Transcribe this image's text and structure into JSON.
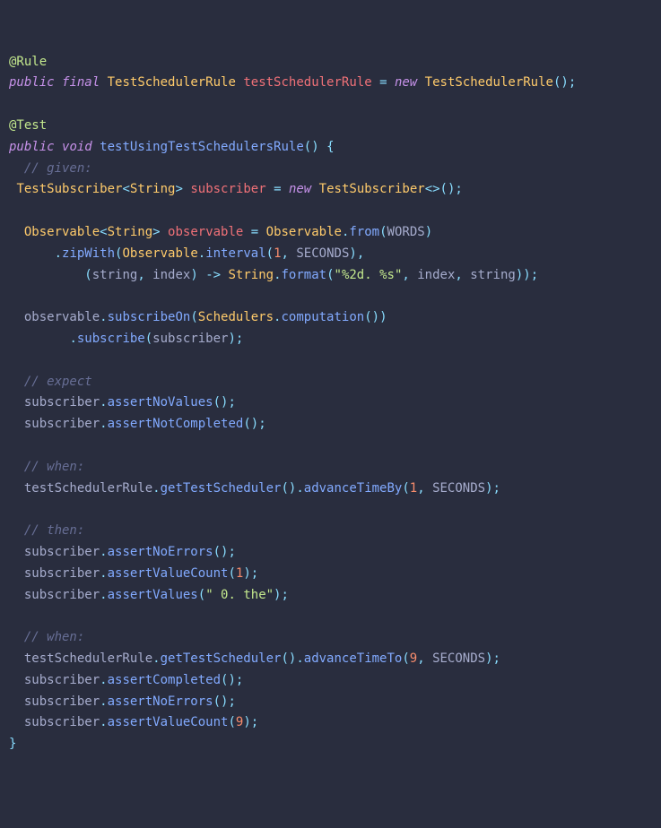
{
  "code": {
    "annotation_rule": "@Rule",
    "kw_public": "public",
    "kw_final": "final",
    "kw_new": "new",
    "kw_void": "void",
    "type_TestSchedulerRule": "TestSchedulerRule",
    "var_testSchedulerRule": "testSchedulerRule",
    "annotation_test": "@Test",
    "method_testUsingTestSchedulersRule": "testUsingTestSchedulersRule",
    "comment_given": "// given:",
    "type_TestSubscriber": "TestSubscriber",
    "type_String": "String",
    "var_subscriber": "subscriber",
    "type_Observable": "Observable",
    "var_observable": "observable",
    "call_from": "from",
    "const_WORDS": "WORDS",
    "call_zipWith": "zipWith",
    "call_interval": "interval",
    "num_1": "1",
    "const_SECONDS": "SECONDS",
    "lambda_string": "string",
    "lambda_index": "index",
    "call_format": "format",
    "str_format": "\"%2d. %s\"",
    "call_subscribeOn": "subscribeOn",
    "type_Schedulers": "Schedulers",
    "call_computation": "computation",
    "call_subscribe": "subscribe",
    "comment_expect": "// expect",
    "call_assertNoValues": "assertNoValues",
    "call_assertNotCompleted": "assertNotCompleted",
    "comment_when": "// when:",
    "call_getTestScheduler": "getTestScheduler",
    "call_advanceTimeBy": "advanceTimeBy",
    "comment_then": "// then:",
    "call_assertNoErrors": "assertNoErrors",
    "call_assertValueCount": "assertValueCount",
    "call_assertValues": "assertValues",
    "str_0the": "\" 0. the\"",
    "call_advanceTimeTo": "advanceTimeTo",
    "num_9": "9",
    "call_assertCompleted": "assertCompleted"
  },
  "p": {
    "eq": " = ",
    "lp": "(",
    "rp": ")",
    "lb": "{",
    "rb": "}",
    "lt": "<",
    "gt": ">",
    "comma": ", ",
    "dot": ".",
    "semi": ";",
    "arrow": " -> ",
    "diamond": "<>",
    "space": " "
  }
}
